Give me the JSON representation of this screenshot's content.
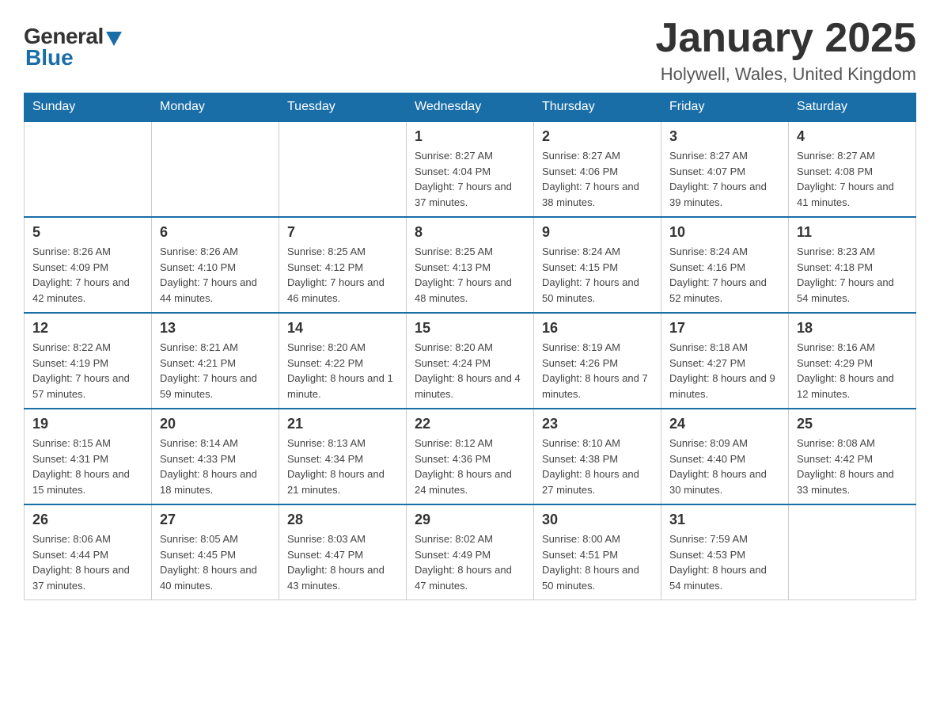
{
  "logo": {
    "general": "General",
    "blue": "Blue"
  },
  "title": "January 2025",
  "subtitle": "Holywell, Wales, United Kingdom",
  "days_of_week": [
    "Sunday",
    "Monday",
    "Tuesday",
    "Wednesday",
    "Thursday",
    "Friday",
    "Saturday"
  ],
  "weeks": [
    [
      {
        "day": "",
        "info": ""
      },
      {
        "day": "",
        "info": ""
      },
      {
        "day": "",
        "info": ""
      },
      {
        "day": "1",
        "info": "Sunrise: 8:27 AM\nSunset: 4:04 PM\nDaylight: 7 hours\nand 37 minutes."
      },
      {
        "day": "2",
        "info": "Sunrise: 8:27 AM\nSunset: 4:06 PM\nDaylight: 7 hours\nand 38 minutes."
      },
      {
        "day": "3",
        "info": "Sunrise: 8:27 AM\nSunset: 4:07 PM\nDaylight: 7 hours\nand 39 minutes."
      },
      {
        "day": "4",
        "info": "Sunrise: 8:27 AM\nSunset: 4:08 PM\nDaylight: 7 hours\nand 41 minutes."
      }
    ],
    [
      {
        "day": "5",
        "info": "Sunrise: 8:26 AM\nSunset: 4:09 PM\nDaylight: 7 hours\nand 42 minutes."
      },
      {
        "day": "6",
        "info": "Sunrise: 8:26 AM\nSunset: 4:10 PM\nDaylight: 7 hours\nand 44 minutes."
      },
      {
        "day": "7",
        "info": "Sunrise: 8:25 AM\nSunset: 4:12 PM\nDaylight: 7 hours\nand 46 minutes."
      },
      {
        "day": "8",
        "info": "Sunrise: 8:25 AM\nSunset: 4:13 PM\nDaylight: 7 hours\nand 48 minutes."
      },
      {
        "day": "9",
        "info": "Sunrise: 8:24 AM\nSunset: 4:15 PM\nDaylight: 7 hours\nand 50 minutes."
      },
      {
        "day": "10",
        "info": "Sunrise: 8:24 AM\nSunset: 4:16 PM\nDaylight: 7 hours\nand 52 minutes."
      },
      {
        "day": "11",
        "info": "Sunrise: 8:23 AM\nSunset: 4:18 PM\nDaylight: 7 hours\nand 54 minutes."
      }
    ],
    [
      {
        "day": "12",
        "info": "Sunrise: 8:22 AM\nSunset: 4:19 PM\nDaylight: 7 hours\nand 57 minutes."
      },
      {
        "day": "13",
        "info": "Sunrise: 8:21 AM\nSunset: 4:21 PM\nDaylight: 7 hours\nand 59 minutes."
      },
      {
        "day": "14",
        "info": "Sunrise: 8:20 AM\nSunset: 4:22 PM\nDaylight: 8 hours\nand 1 minute."
      },
      {
        "day": "15",
        "info": "Sunrise: 8:20 AM\nSunset: 4:24 PM\nDaylight: 8 hours\nand 4 minutes."
      },
      {
        "day": "16",
        "info": "Sunrise: 8:19 AM\nSunset: 4:26 PM\nDaylight: 8 hours\nand 7 minutes."
      },
      {
        "day": "17",
        "info": "Sunrise: 8:18 AM\nSunset: 4:27 PM\nDaylight: 8 hours\nand 9 minutes."
      },
      {
        "day": "18",
        "info": "Sunrise: 8:16 AM\nSunset: 4:29 PM\nDaylight: 8 hours\nand 12 minutes."
      }
    ],
    [
      {
        "day": "19",
        "info": "Sunrise: 8:15 AM\nSunset: 4:31 PM\nDaylight: 8 hours\nand 15 minutes."
      },
      {
        "day": "20",
        "info": "Sunrise: 8:14 AM\nSunset: 4:33 PM\nDaylight: 8 hours\nand 18 minutes."
      },
      {
        "day": "21",
        "info": "Sunrise: 8:13 AM\nSunset: 4:34 PM\nDaylight: 8 hours\nand 21 minutes."
      },
      {
        "day": "22",
        "info": "Sunrise: 8:12 AM\nSunset: 4:36 PM\nDaylight: 8 hours\nand 24 minutes."
      },
      {
        "day": "23",
        "info": "Sunrise: 8:10 AM\nSunset: 4:38 PM\nDaylight: 8 hours\nand 27 minutes."
      },
      {
        "day": "24",
        "info": "Sunrise: 8:09 AM\nSunset: 4:40 PM\nDaylight: 8 hours\nand 30 minutes."
      },
      {
        "day": "25",
        "info": "Sunrise: 8:08 AM\nSunset: 4:42 PM\nDaylight: 8 hours\nand 33 minutes."
      }
    ],
    [
      {
        "day": "26",
        "info": "Sunrise: 8:06 AM\nSunset: 4:44 PM\nDaylight: 8 hours\nand 37 minutes."
      },
      {
        "day": "27",
        "info": "Sunrise: 8:05 AM\nSunset: 4:45 PM\nDaylight: 8 hours\nand 40 minutes."
      },
      {
        "day": "28",
        "info": "Sunrise: 8:03 AM\nSunset: 4:47 PM\nDaylight: 8 hours\nand 43 minutes."
      },
      {
        "day": "29",
        "info": "Sunrise: 8:02 AM\nSunset: 4:49 PM\nDaylight: 8 hours\nand 47 minutes."
      },
      {
        "day": "30",
        "info": "Sunrise: 8:00 AM\nSunset: 4:51 PM\nDaylight: 8 hours\nand 50 minutes."
      },
      {
        "day": "31",
        "info": "Sunrise: 7:59 AM\nSunset: 4:53 PM\nDaylight: 8 hours\nand 54 minutes."
      },
      {
        "day": "",
        "info": ""
      }
    ]
  ]
}
